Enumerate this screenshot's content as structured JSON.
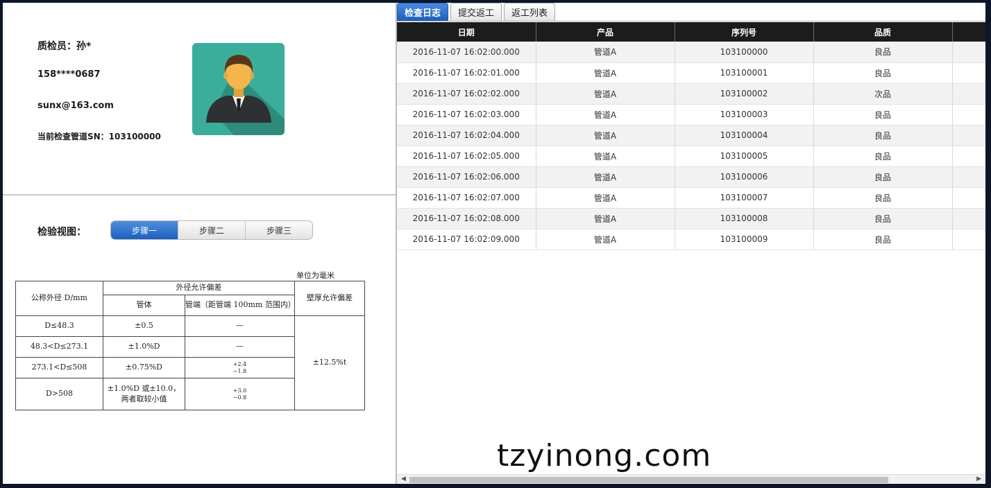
{
  "inspector": {
    "name_line": "质检员：孙*",
    "phone": "158****0687",
    "email": "sunx@163.com",
    "current_sn_line": "当前检查管道SN：103100000"
  },
  "view": {
    "label": "检验视图：",
    "steps": [
      "步骤一",
      "步骤二",
      "步骤三"
    ],
    "active_step": "步骤一"
  },
  "spec_table": {
    "unit_note": "单位为毫米",
    "header_nominal": "公称外径 D/mm",
    "header_od_tolerance": "外径允许偏差",
    "header_body": "管体",
    "header_end": "管端（距管端 100mm 范围内）",
    "header_wall": "壁厚允许偏差",
    "rows": [
      {
        "range": "D≤48.3",
        "body": "±0.5",
        "end": "—",
        "end_plus": "",
        "end_minus": ""
      },
      {
        "range": "48.3<D≤273.1",
        "body": "±1.0%D",
        "end": "—",
        "end_plus": "",
        "end_minus": ""
      },
      {
        "range": "273.1<D≤508",
        "body": "±0.75%D",
        "end": "",
        "end_plus": "+2.4",
        "end_minus": "−1.8"
      },
      {
        "range": "D>508",
        "body": "±1.0%D 或±10.0，两者取较小值",
        "end": "",
        "end_plus": "+3.0",
        "end_minus": "−0.8"
      }
    ],
    "wall_tolerance": "±12.5%t"
  },
  "tabs": [
    "检查日志",
    "提交返工",
    "返工列表"
  ],
  "active_tab": "检查日志",
  "grid": {
    "columns": [
      "日期",
      "产品",
      "序列号",
      "品质"
    ],
    "rows": [
      [
        "2016-11-07 16:02:00.000",
        "管道A",
        "103100000",
        "良品"
      ],
      [
        "2016-11-07 16:02:01.000",
        "管道A",
        "103100001",
        "良品"
      ],
      [
        "2016-11-07 16:02:02.000",
        "管道A",
        "103100002",
        "次品"
      ],
      [
        "2016-11-07 16:02:03.000",
        "管道A",
        "103100003",
        "良品"
      ],
      [
        "2016-11-07 16:02:04.000",
        "管道A",
        "103100004",
        "良品"
      ],
      [
        "2016-11-07 16:02:05.000",
        "管道A",
        "103100005",
        "良品"
      ],
      [
        "2016-11-07 16:02:06.000",
        "管道A",
        "103100006",
        "良品"
      ],
      [
        "2016-11-07 16:02:07.000",
        "管道A",
        "103100007",
        "良品"
      ],
      [
        "2016-11-07 16:02:08.000",
        "管道A",
        "103100008",
        "良品"
      ],
      [
        "2016-11-07 16:02:09.000",
        "管道A",
        "103100009",
        "良品"
      ]
    ]
  },
  "watermark": "tzyinong.com",
  "colors": {
    "accent": "#1d5fbd",
    "header_bg": "#1c1c1c",
    "avatar_bg": "#3aae9b"
  },
  "icons": {
    "avatar": "businessman-avatar-icon",
    "scroll_left": "arrow-left-icon",
    "scroll_right": "arrow-right-icon"
  }
}
